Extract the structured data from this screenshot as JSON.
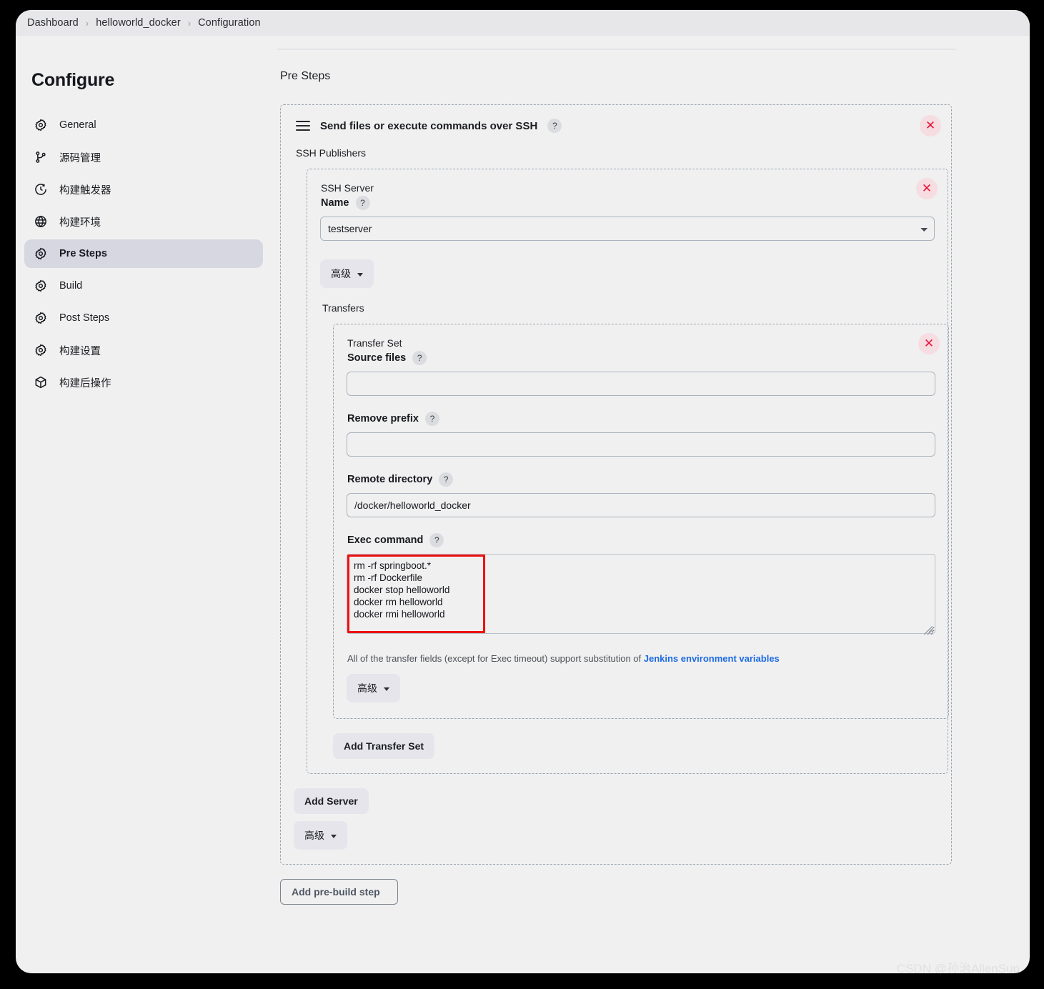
{
  "breadcrumb": {
    "items": [
      "Dashboard",
      "helloworld_docker",
      "Configuration"
    ],
    "separator": "›"
  },
  "sidebar": {
    "title": "Configure",
    "items": [
      {
        "label": "General",
        "icon": "gear-icon",
        "active": false
      },
      {
        "label": "源码管理",
        "icon": "branch-icon",
        "active": false
      },
      {
        "label": "构建触发器",
        "icon": "clock-icon",
        "active": false
      },
      {
        "label": "构建环境",
        "icon": "globe-icon",
        "active": false
      },
      {
        "label": "Pre Steps",
        "icon": "gear-icon",
        "active": true
      },
      {
        "label": "Build",
        "icon": "gear-icon",
        "active": false
      },
      {
        "label": "Post Steps",
        "icon": "gear-icon",
        "active": false
      },
      {
        "label": "构建设置",
        "icon": "gear-icon",
        "active": false
      },
      {
        "label": "构建后操作",
        "icon": "box-icon",
        "active": false
      }
    ]
  },
  "main": {
    "section_title": "Pre Steps",
    "step": {
      "title": "Send files or execute commands over SSH",
      "help": "?",
      "delete": "✕",
      "publishers_label": "SSH Publishers"
    },
    "server": {
      "heading": "SSH Server",
      "name_label": "Name",
      "name_help": "?",
      "name_value": "testserver",
      "name_options": [
        "testserver"
      ],
      "advanced_label": "高级",
      "transfers_label": "Transfers",
      "delete": "✕"
    },
    "transfer_set": {
      "heading": "Transfer Set",
      "delete": "✕",
      "fields": [
        {
          "label": "Source files",
          "help": "?",
          "value": "",
          "placeholder": ""
        },
        {
          "label": "Remove prefix",
          "help": "?",
          "value": "",
          "placeholder": ""
        },
        {
          "label": "Remote directory",
          "help": "?",
          "value": "/docker/helloworld_docker",
          "placeholder": ""
        }
      ],
      "exec_label": "Exec command",
      "exec_help": "?",
      "exec_value": "rm -rf springboot.*\nrm -rf Dockerfile\ndocker stop helloworld\ndocker rm helloworld\ndocker rmi helloworld",
      "note_prefix": "All of the transfer fields (except for Exec timeout) support substitution of ",
      "note_link": "Jenkins environment variables",
      "advanced_label": "高级"
    },
    "buttons": {
      "add_transfer_set": "Add Transfer Set",
      "add_server": "Add Server",
      "server_advanced": "高级",
      "add_pre_build_step": "Add pre-build step"
    }
  },
  "watermark": "CSDN @孙治AllenSun",
  "colors": {
    "accent_link": "#1c6ae4",
    "delete_red": "#e8143c",
    "highlight_red": "#ee1111",
    "sidebar_active": "#d7d7e1",
    "dashed_border": "#9aa5b1"
  }
}
